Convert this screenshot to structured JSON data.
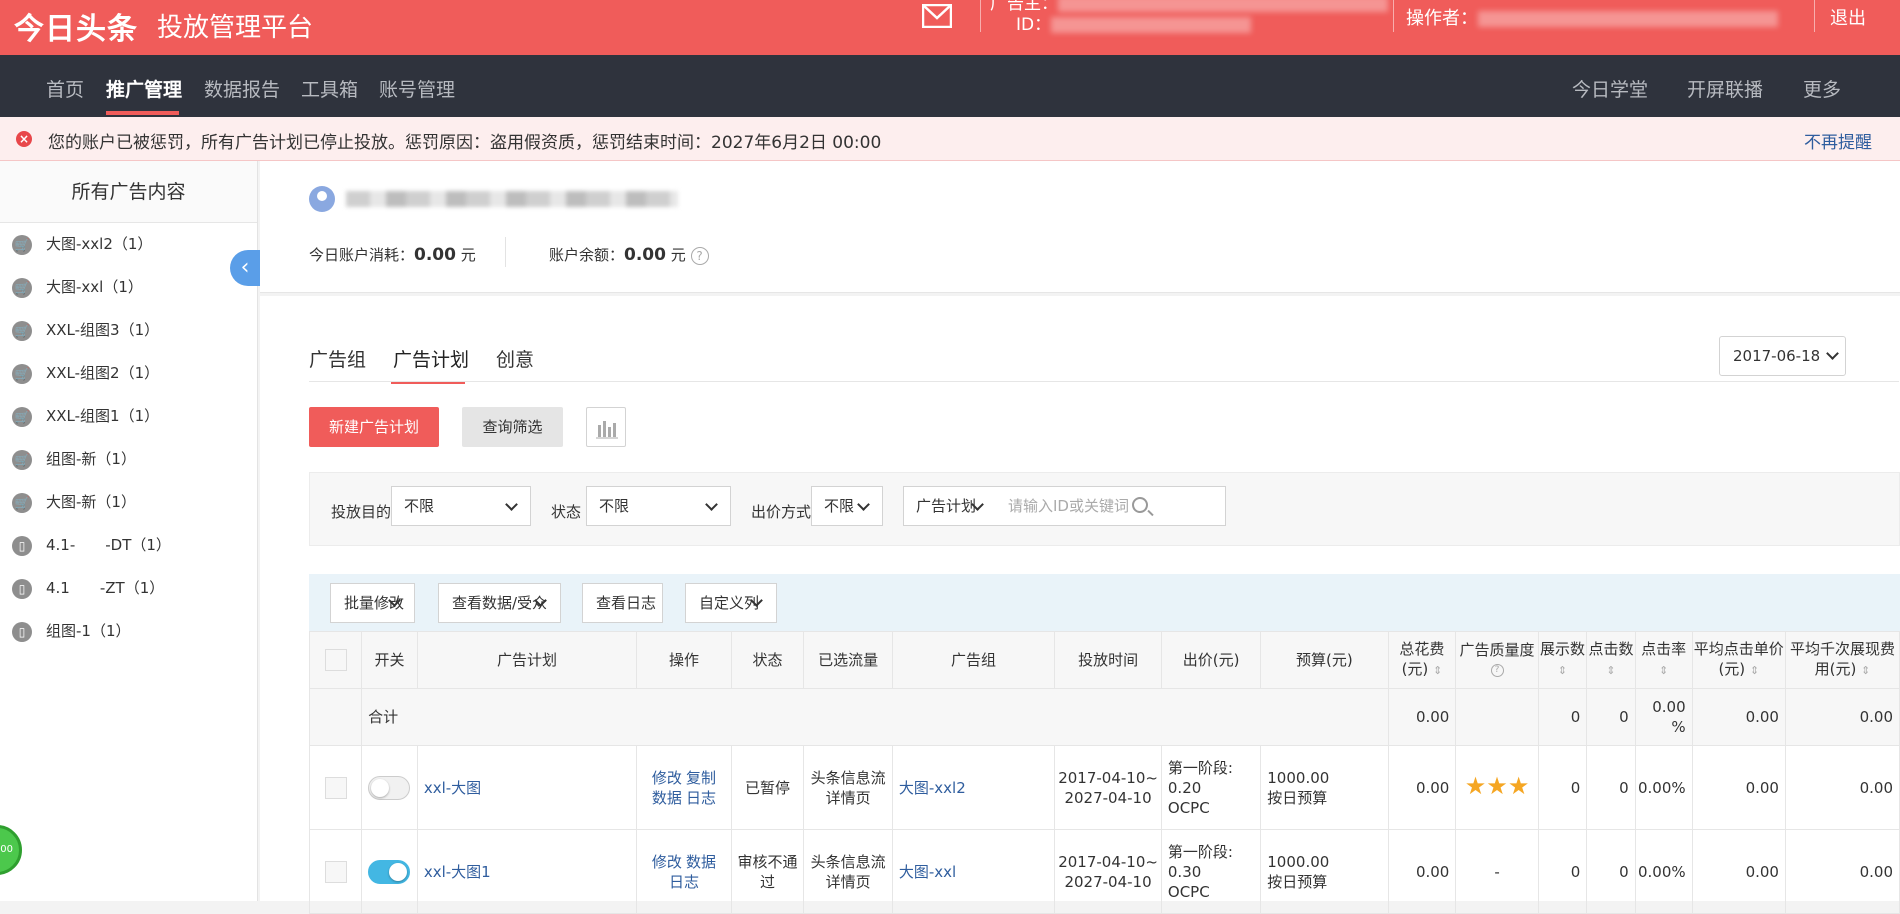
{
  "topbar": {
    "logo": "今日头条",
    "platform": "投放管理平台",
    "advertiser_label": "广告主：",
    "id_label": "ID：",
    "operator_label": "操作者：",
    "logout": "退出"
  },
  "nav": {
    "items": [
      "首页",
      "推广管理",
      "数据报告",
      "工具箱",
      "账号管理"
    ],
    "right_items": [
      "今日学堂",
      "开屏联播",
      "更多"
    ]
  },
  "alert": {
    "message": "您的账户已被惩罚，所有广告计划已停止投放。惩罚原因：盗用假资质，惩罚结束时间：2027年6月2日 00:00",
    "dismiss": "不再提醒"
  },
  "sidebar": {
    "title": "所有广告内容",
    "items": [
      {
        "label": "大图-xxl2（1）",
        "icon": "cart-icon"
      },
      {
        "label": "大图-xxl（1）",
        "icon": "cart-icon"
      },
      {
        "label": "XXL-组图3（1）",
        "icon": "cart-icon"
      },
      {
        "label": "XXL-组图2（1）",
        "icon": "cart-icon"
      },
      {
        "label": "XXL-组图1（1）",
        "icon": "cart-icon"
      },
      {
        "label": "组图-新（1）",
        "icon": "cart-icon"
      },
      {
        "label": "大图-新（1）",
        "icon": "cart-icon"
      },
      {
        "label": "4.1-　　-DT（1）",
        "icon": "phone-icon"
      },
      {
        "label": "4.1　　-ZT（1）",
        "icon": "phone-icon"
      },
      {
        "label": "组图-1（1）",
        "icon": "phone-icon"
      }
    ]
  },
  "account": {
    "today_cost_label": "今日账户消耗：",
    "today_cost": "0.00",
    "balance_label": "账户余额：",
    "balance": "0.00",
    "unit": "元"
  },
  "tabs": [
    "广告组",
    "广告计划",
    "创意"
  ],
  "date": "2017-06-18",
  "buttons": {
    "new_plan": "新建广告计划",
    "query": "查询筛选"
  },
  "filters": {
    "goal_label": "投放目的",
    "goal_value": "不限",
    "status_label": "状态",
    "status_value": "不限",
    "bid_label": "出价方式",
    "bid_value": "不限",
    "scope_value": "广告计划",
    "search_placeholder": "请输入ID或关键词"
  },
  "toolbar": {
    "batch_edit": "批量修改",
    "view_data": "查看数据/受众",
    "view_log": "查看日志",
    "custom_columns": "自定义列"
  },
  "table": {
    "headers": [
      "开关",
      "广告计划",
      "操作",
      "状态",
      "已选流量",
      "广告组",
      "投放时间",
      "出价(元)",
      "预算(元)",
      "总花费(元)",
      "广告质量度",
      "展示数",
      "点击数",
      "点击率",
      "平均点击单价(元)",
      "平均千次展现费用(元)"
    ],
    "sum_row": {
      "label": "合计",
      "total_cost": "0.00",
      "impressions": "0",
      "clicks": "0",
      "ctr": "0.00 %",
      "cpc": "0.00",
      "cpm": "0.00"
    },
    "rows": [
      {
        "toggle_on": false,
        "plan": "xxl-大图",
        "ops": [
          "修改",
          "复制",
          "数据",
          "日志"
        ],
        "status": "已暂停",
        "traffic": "头条信息流详情页",
        "group": "大图-xxl2",
        "time_start": "2017-04-10~",
        "time_end": "2027-04-10",
        "bid_stage": "第一阶段:",
        "bid_value": "0.20",
        "bid_type": "OCPC",
        "budget": "1000.00",
        "budget_type": "按日预算",
        "total_cost": "0.00",
        "quality_stars": 3,
        "impressions": "0",
        "clicks": "0",
        "ctr": "0.00%",
        "cpc": "0.00",
        "cpm": "0.00"
      },
      {
        "toggle_on": true,
        "plan": "xxl-大图1",
        "ops": [
          "修改",
          "数据",
          "日志"
        ],
        "status": "审核不通过",
        "traffic": "头条信息流详情页",
        "group": "大图-xxl",
        "time_start": "2017-04-10~",
        "time_end": "2027-04-10",
        "bid_stage": "第一阶段:",
        "bid_value": "0.30",
        "bid_type": "OCPC",
        "budget": "1000.00",
        "budget_type": "按日预算",
        "total_cost": "0.00",
        "quality": "-",
        "impressions": "0",
        "clicks": "0",
        "ctr": "0.00%",
        "cpc": "0.00",
        "cpm": "0.00"
      }
    ]
  },
  "colors": {
    "brand_red": "#f05c5a",
    "nav_dark": "#2f333d",
    "link_blue": "#2f5d9e",
    "toggle_on": "#43b7e3",
    "star": "#f5a623"
  }
}
